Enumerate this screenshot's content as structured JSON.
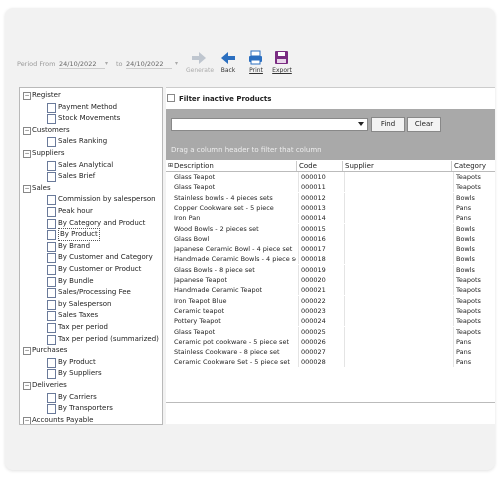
{
  "toolbar": {
    "period_from_label": "Period From",
    "date_from": "24/10/2022",
    "to_label": "to",
    "date_to": "24/10/2022",
    "generate_label": "Generate",
    "back_label": "Back",
    "print_label": "Print",
    "export_label": "Export"
  },
  "tree": [
    {
      "type": "group",
      "label": "Register"
    },
    {
      "type": "leaf",
      "label": "Payment Method"
    },
    {
      "type": "leaf",
      "label": "Stock Movements"
    },
    {
      "type": "group",
      "label": "Customers"
    },
    {
      "type": "leaf",
      "label": "Sales Ranking"
    },
    {
      "type": "group",
      "label": "Suppliers"
    },
    {
      "type": "leaf",
      "label": "Sales Analytical"
    },
    {
      "type": "leaf",
      "label": "Sales Brief"
    },
    {
      "type": "group",
      "label": "Sales"
    },
    {
      "type": "leaf",
      "label": "Commission by salesperson"
    },
    {
      "type": "leaf",
      "label": "Peak hour"
    },
    {
      "type": "leaf",
      "label": "By Category and Product"
    },
    {
      "type": "leaf",
      "label": "By Product",
      "selected": true
    },
    {
      "type": "leaf",
      "label": "By Brand"
    },
    {
      "type": "leaf",
      "label": "By Customer and Category"
    },
    {
      "type": "leaf",
      "label": "By Customer or Product"
    },
    {
      "type": "leaf",
      "label": "By Bundle"
    },
    {
      "type": "leaf",
      "label": "Sales/Processing Fee"
    },
    {
      "type": "leaf",
      "label": "by Salesperson"
    },
    {
      "type": "leaf",
      "label": "Sales Taxes"
    },
    {
      "type": "leaf",
      "label": "Tax per period"
    },
    {
      "type": "leaf",
      "label": "Tax per period (summarized)"
    },
    {
      "type": "group",
      "label": "Purchases"
    },
    {
      "type": "leaf",
      "label": "By Product"
    },
    {
      "type": "leaf",
      "label": "By Suppliers"
    },
    {
      "type": "group",
      "label": "Deliveries"
    },
    {
      "type": "leaf",
      "label": "By Carriers"
    },
    {
      "type": "leaf",
      "label": "By Transporters"
    },
    {
      "type": "group",
      "label": "Accounts Payable"
    }
  ],
  "filter": {
    "inactive_label": "Filter inactive Products",
    "find_label": "Find",
    "clear_label": "Clear",
    "drag_hint": "Drag a column header to filter that column"
  },
  "table": {
    "headers": [
      "Description",
      "Code",
      "Supplier",
      "Category"
    ],
    "rows": [
      [
        "Glass Teapot",
        "000010",
        "",
        "Teapots"
      ],
      [
        "Glass Teapot",
        "000011",
        "",
        "Teapots"
      ],
      [
        "Stainless bowls - 4 pieces sets",
        "000012",
        "",
        "Bowls"
      ],
      [
        "Copper Cookware set - 5 piece",
        "000013",
        "",
        "Pans"
      ],
      [
        "Iron Pan",
        "000014",
        "",
        "Pans"
      ],
      [
        "Wood Bowls - 2 pieces set",
        "000015",
        "",
        "Bowls"
      ],
      [
        "Glass Bowl",
        "000016",
        "",
        "Bowls"
      ],
      [
        "Japanese Ceramic Bowl - 4 piece set",
        "000017",
        "",
        "Bowls"
      ],
      [
        "Handmade Ceramic Bowls - 4 piece set",
        "000018",
        "",
        "Bowls"
      ],
      [
        "Glass Bowls - 8 piece set",
        "000019",
        "",
        "Bowls"
      ],
      [
        "Japanese Teapot",
        "000020",
        "",
        "Teapots"
      ],
      [
        "Handmade Ceramic Teapot",
        "000021",
        "",
        "Teapots"
      ],
      [
        "Iron Teapot Blue",
        "000022",
        "",
        "Teapots"
      ],
      [
        "Ceramic teapot",
        "000023",
        "",
        "Teapots"
      ],
      [
        "Pottery Teapot",
        "000024",
        "",
        "Teapots"
      ],
      [
        "Glass Teapot",
        "000025",
        "",
        "Teapots"
      ],
      [
        "Ceramic pot cookware - 5 piece set",
        "000026",
        "",
        "Pans"
      ],
      [
        "Stainless Cookware - 8 piece set",
        "000027",
        "",
        "Pans"
      ],
      [
        "Ceramic Cookware Set - 5 piece set",
        "000028",
        "",
        "Pans"
      ]
    ]
  },
  "icons": {
    "generate": "arrow-right-icon",
    "back": "arrow-left-icon",
    "print": "printer-icon",
    "export": "save-disk-icon"
  },
  "colors": {
    "accent_blue": "#2b6fc0",
    "export_purple": "#7a2c82",
    "panel_grey": "#a9a9a9"
  }
}
